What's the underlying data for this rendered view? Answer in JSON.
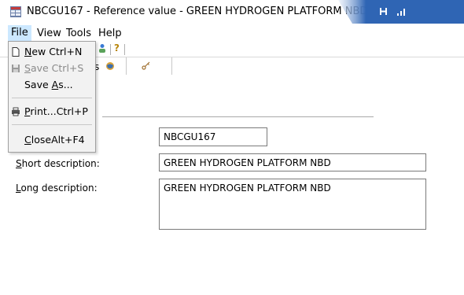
{
  "window": {
    "title": "NBCGU167 - Reference value - GREEN HYDROGEN PLATFORM NBD"
  },
  "menubar": {
    "items": [
      "File",
      "View",
      "Tools",
      "Help"
    ]
  },
  "toolbar": {
    "help_glyph": "?",
    "partial_tab_text": "s"
  },
  "file_menu": {
    "new": {
      "first": "N",
      "rest": "ew",
      "shortcut": "Ctrl+N"
    },
    "save": {
      "first": "S",
      "rest": "ave",
      "shortcut": "Ctrl+S"
    },
    "save_as": {
      "prefix": "Save ",
      "underlined": "A",
      "suffix": "s..."
    },
    "print": {
      "first": "P",
      "rest": "rint...",
      "shortcut": "Ctrl+P"
    },
    "close": {
      "first": "C",
      "rest": "lose",
      "shortcut": "Alt+F4"
    }
  },
  "form": {
    "code_value": "NBCGU167",
    "short_label_ul": "S",
    "short_label_rest": "hort description:",
    "short_value": "GREEN HYDROGEN PLATFORM NBD",
    "long_label_ul": "L",
    "long_label_rest": "ong description:",
    "long_value": "GREEN HYDROGEN PLATFORM NBD"
  },
  "colors": {
    "menu_highlight": "#cce8ff",
    "signal_tab": "#2f65b4",
    "signal_tab_fade": "#e6eef9"
  }
}
